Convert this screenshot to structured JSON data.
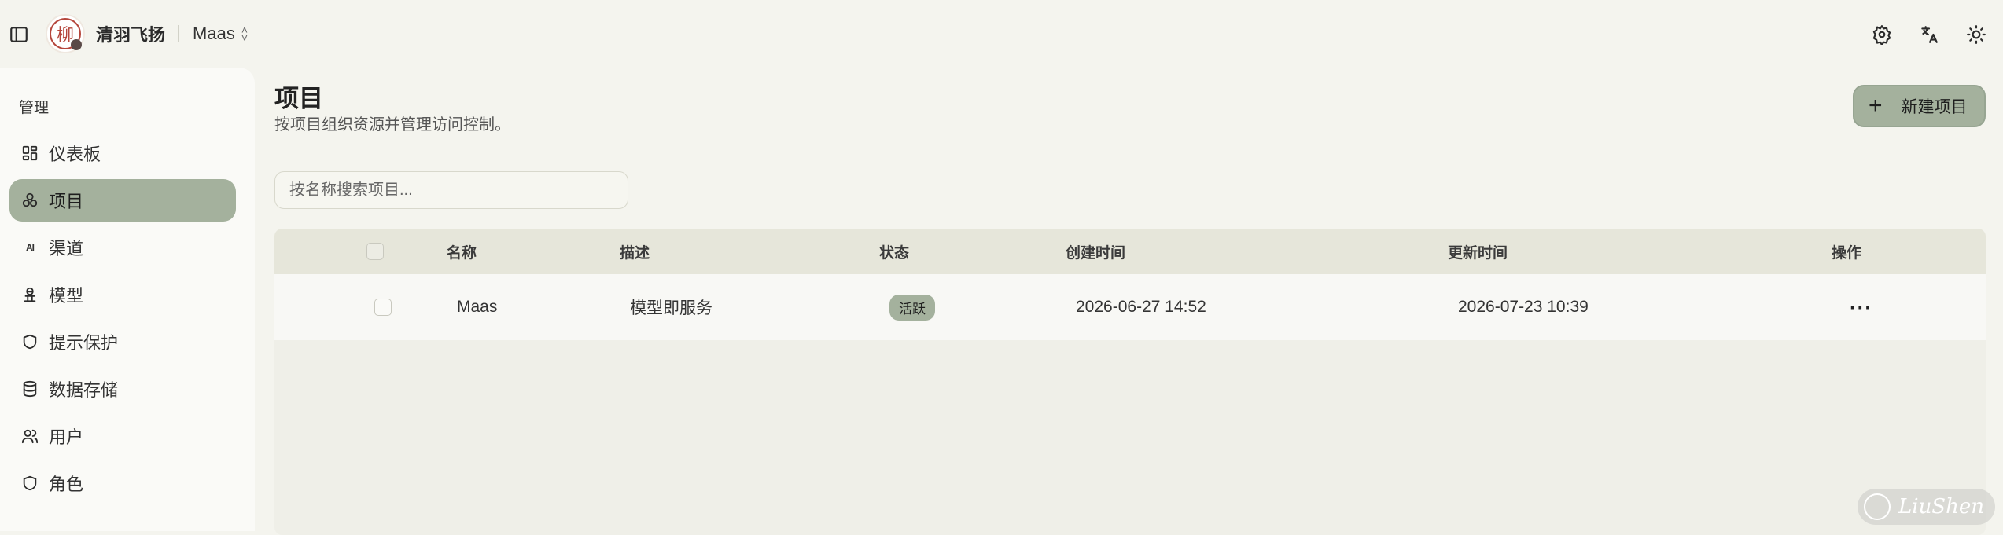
{
  "header": {
    "brand_name": "清羽飞扬",
    "logo_char": "柳",
    "project": "Maas"
  },
  "sidebar": {
    "group_label": "管理",
    "items": [
      {
        "label": "仪表板",
        "icon": "dashboard-icon"
      },
      {
        "label": "项目",
        "icon": "projects-icon",
        "active": true
      },
      {
        "label": "渠道",
        "icon": "ai-icon",
        "icon_text": "AI"
      },
      {
        "label": "模型",
        "icon": "model-icon"
      },
      {
        "label": "提示保护",
        "icon": "shield-icon"
      },
      {
        "label": "数据存储",
        "icon": "database-icon"
      },
      {
        "label": "用户",
        "icon": "users-icon"
      },
      {
        "label": "角色",
        "icon": "role-shield-icon"
      }
    ]
  },
  "main": {
    "title": "项目",
    "subtitle": "按项目组织资源并管理访问控制。",
    "new_button": "新建项目",
    "search_placeholder": "按名称搜索项目...",
    "table": {
      "headers": {
        "name": "名称",
        "description": "描述",
        "status": "状态",
        "created": "创建时间",
        "updated": "更新时间",
        "actions": "操作"
      },
      "rows": [
        {
          "name": "Maas",
          "description": "模型即服务",
          "status": "活跃",
          "created": "2026-06-27 14:52",
          "updated": "2026-07-23 10:39",
          "actions": "···"
        }
      ]
    }
  },
  "watermark": "LiuShen",
  "colors": {
    "background": "#f4f4ee",
    "accent": "#a4b19d",
    "seal": "#b5463c"
  }
}
